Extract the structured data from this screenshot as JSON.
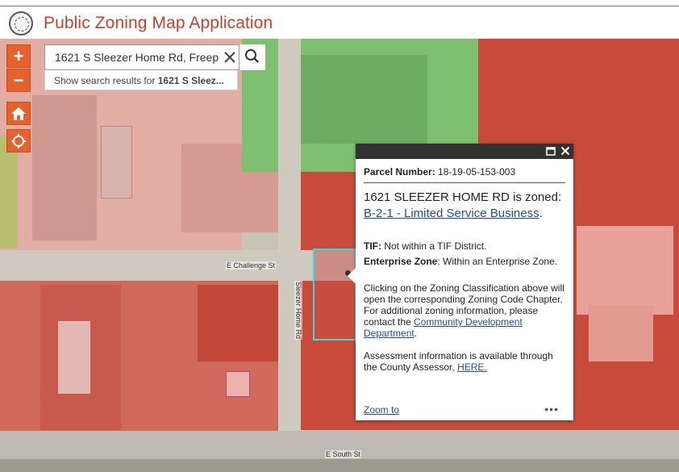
{
  "app": {
    "title": "Public Zoning Map Application"
  },
  "search": {
    "value": "1621 S Sleezer Home Rd, Freep",
    "suggestion_prefix": "Show search results for ",
    "suggestion_bold": "1621 S Sleez..."
  },
  "controls": {
    "zoom_in": "+",
    "zoom_out": "−"
  },
  "map": {
    "streets": {
      "challenge": "E Challenge St",
      "sleezer": "Sleezer Home Rd",
      "south": "E South St"
    },
    "colors": {
      "commercial_zone": "#c84a3a",
      "green_zone": "#7ec070",
      "parcel_outline": "#3ed8d8"
    }
  },
  "popup": {
    "parcel_label": "Parcel Number:",
    "parcel_number": "18-19-05-153-003",
    "address": "1621 SLEEZER HOME RD",
    "zoned_text": " is zoned:",
    "zoning_link": "B-2-1 - Limited Service Business",
    "tif_label": "TIF:",
    "tif_value": " Not within a TIF District.",
    "ez_label": "Enterprise Zone",
    "ez_value": ": Within an Enterprise Zone.",
    "note_text": "Clicking on the Zoning Classification above will open the corresponding Zoning Code Chapter. For additional zoning information, please contact the ",
    "dept_link": "Community Development Department",
    "assess_text": "Assessment information is available through the County Assessor, ",
    "assess_link": "HERE.",
    "zoom_to": "Zoom to",
    "more": "•••"
  }
}
